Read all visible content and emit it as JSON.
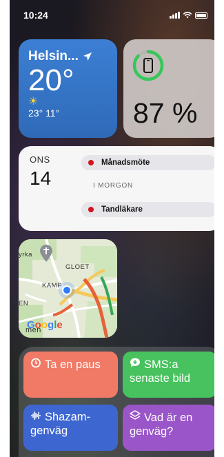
{
  "status_bar": {
    "time": "10:24"
  },
  "weather": {
    "city": "Helsin...",
    "temperature": "20°",
    "high": "23°",
    "low": "11°"
  },
  "battery": {
    "percent_label": "87 %",
    "level": 0.87
  },
  "calendar": {
    "weekday": "ONS",
    "day": "14",
    "events": [
      {
        "title": "Månadsmöte",
        "color": "#d4121e"
      },
      {
        "title": "Tandläkare",
        "color": "#d4121e"
      }
    ],
    "morning_label": "I MORGON"
  },
  "map": {
    "labels": [
      "yrka",
      "GLOET",
      "KAMP",
      "EN",
      "men"
    ],
    "logo": "Google"
  },
  "shortcuts": [
    {
      "label": "Ta en paus",
      "icon": "timer-icon",
      "color": "#f07a66"
    },
    {
      "label": "SMS:a senaste bild",
      "icon": "message-icon",
      "color": "#47c25e"
    },
    {
      "label": "Shazam-genväg",
      "icon": "waveform-icon",
      "color": "#3e66d1"
    },
    {
      "label": "Vad är en genväg?",
      "icon": "shortcuts-icon",
      "color": "#9a55c9"
    }
  ]
}
